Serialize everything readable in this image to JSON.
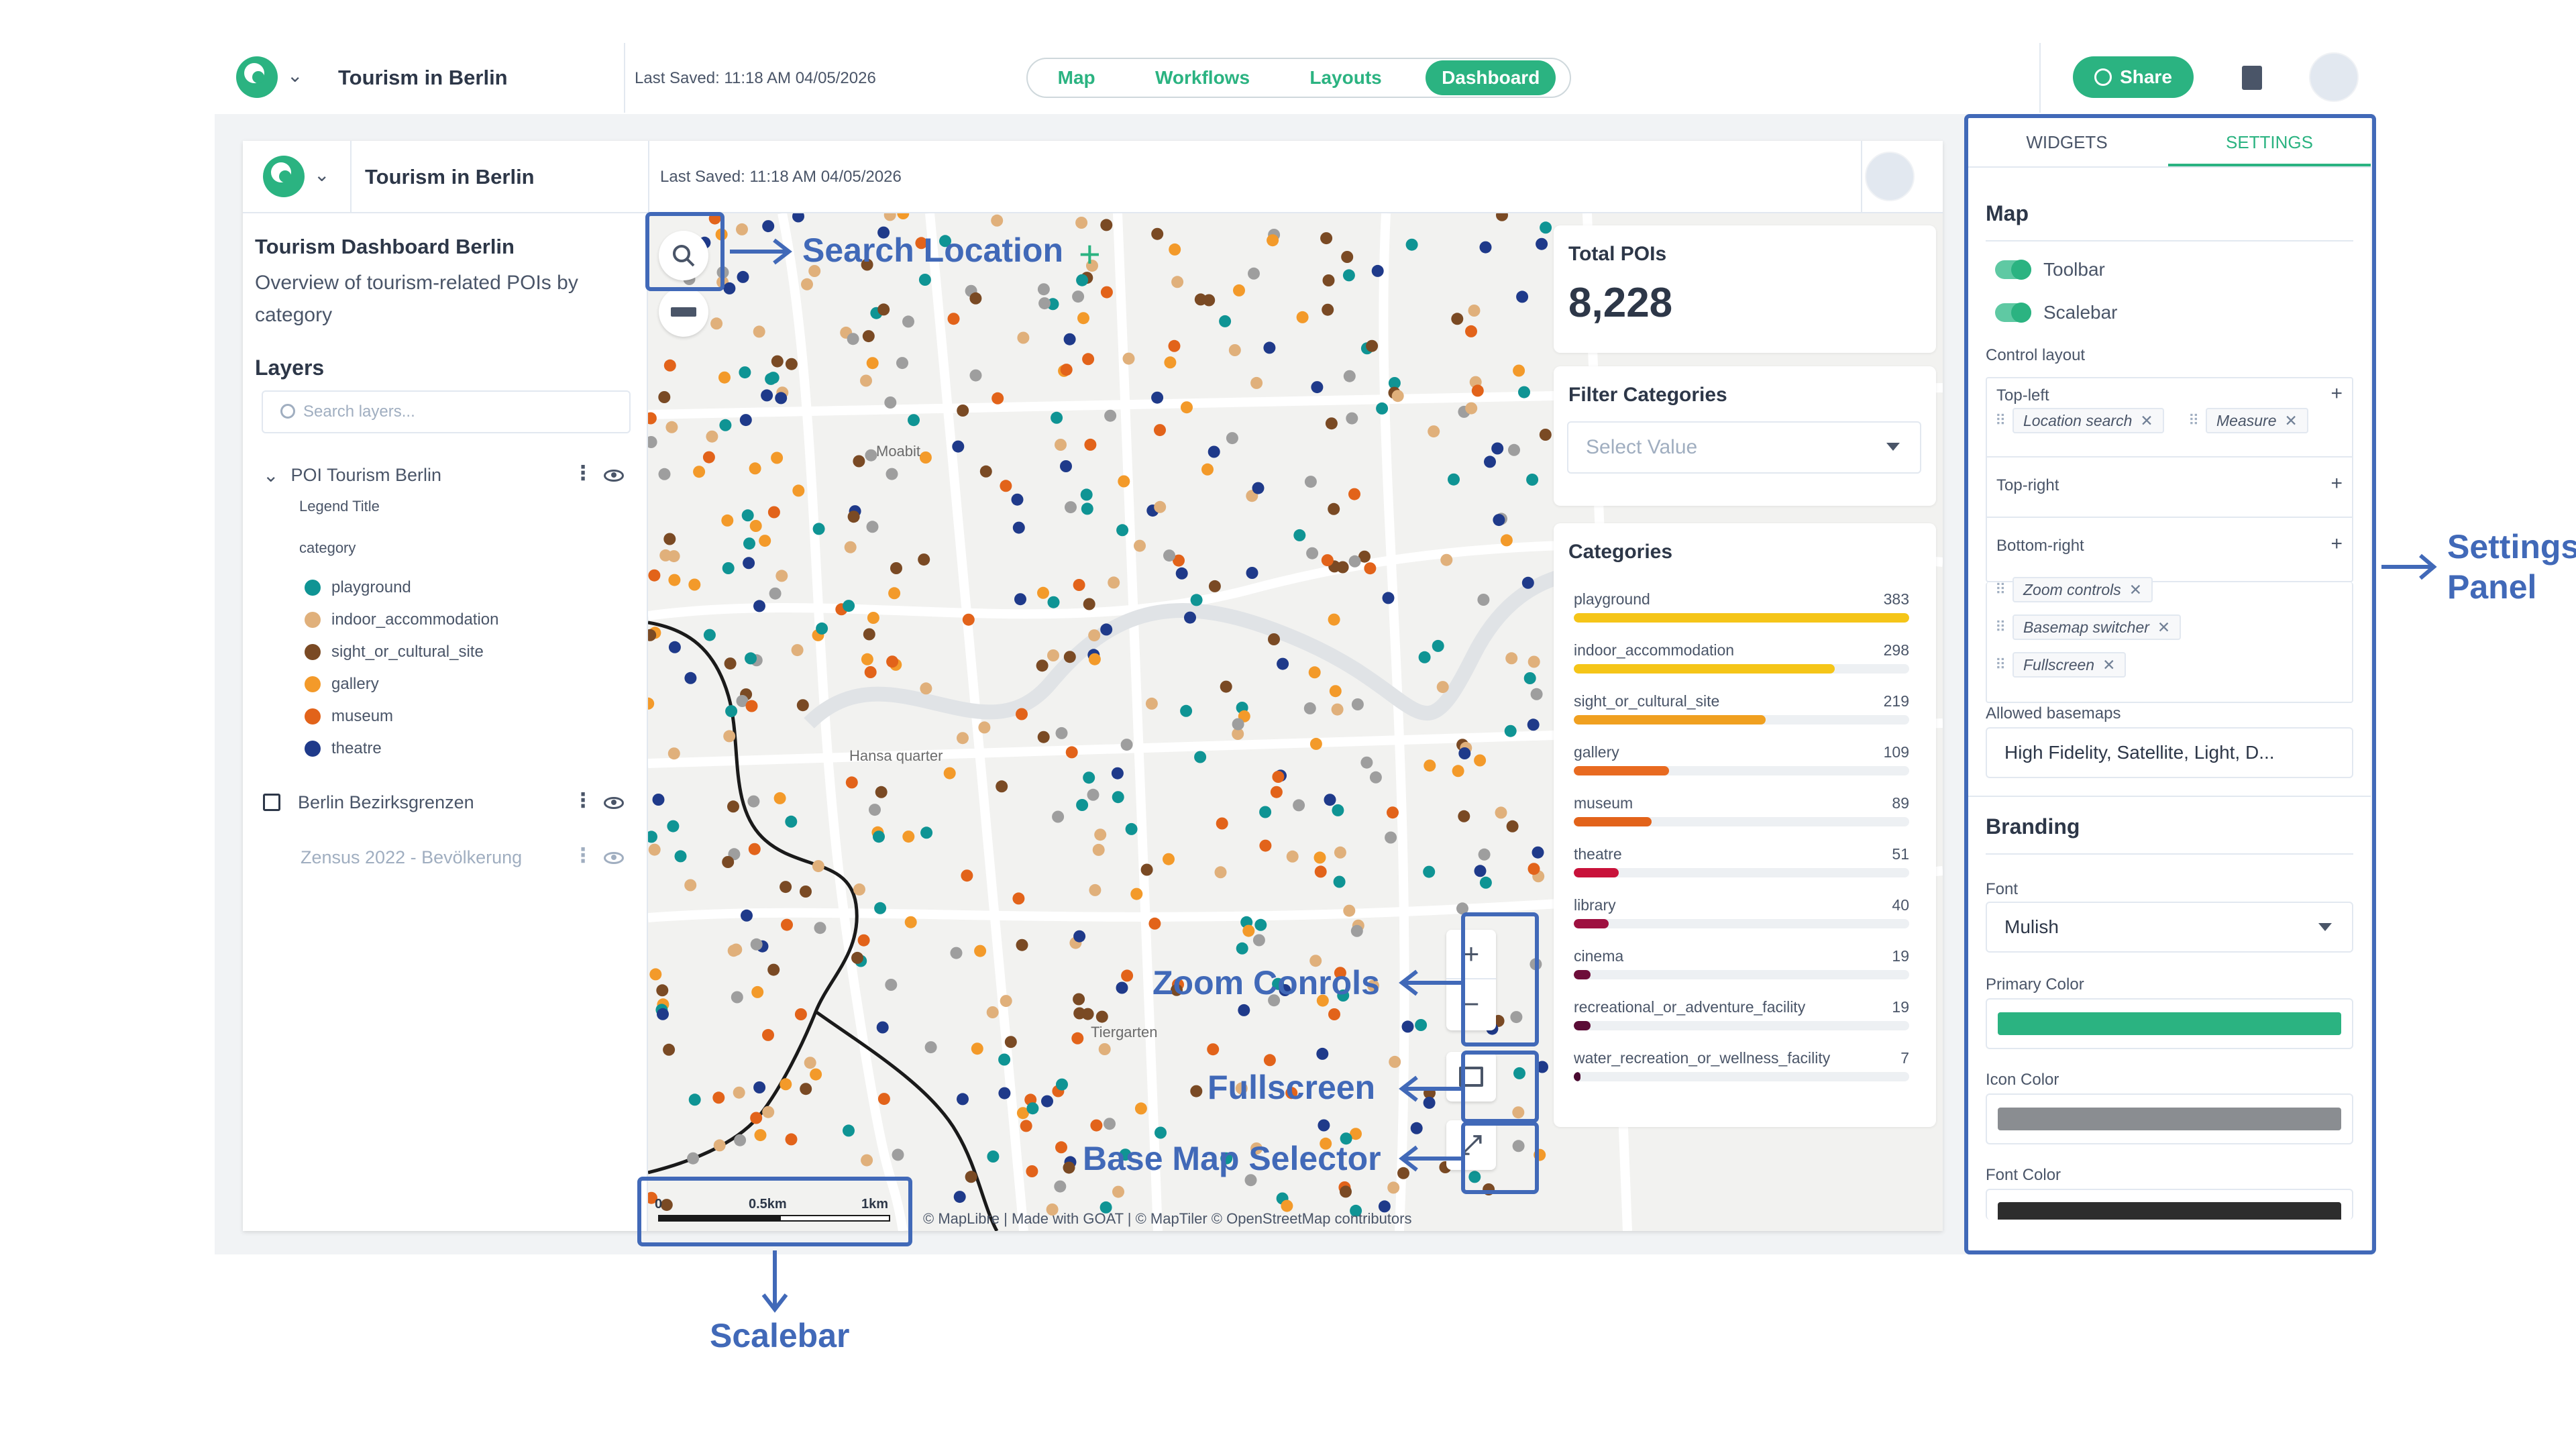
{
  "app": {
    "project_title": "Tourism in Berlin",
    "last_saved": "Last Saved: 11:18 AM 04/05/2026",
    "tabs": [
      {
        "label": "Map",
        "active": false
      },
      {
        "label": "Workflows",
        "active": false
      },
      {
        "label": "Layouts",
        "active": false
      },
      {
        "label": "Dashboard",
        "active": true
      }
    ],
    "share_label": "Share",
    "accent_color": "#2bb381"
  },
  "dashboard": {
    "title": "Tourism Dashboard Berlin",
    "description": "Overview of tourism-related POIs by category",
    "layers_heading": "Layers",
    "search_placeholder": "Search layers...",
    "layers": [
      {
        "name": "POI Tourism Berlin",
        "legend_title": "Legend Title",
        "legend_group": "category"
      },
      {
        "name": "Berlin Bezirksgrenzen"
      },
      {
        "name": "Zensus 2022 - Bevölkerung"
      }
    ],
    "legend": [
      {
        "label": "playground",
        "color": "#0f9494"
      },
      {
        "label": "indoor_accommodation",
        "color": "#e0b07b"
      },
      {
        "label": "sight_or_cultural_site",
        "color": "#7a4a24"
      },
      {
        "label": "gallery",
        "color": "#f39a2a"
      },
      {
        "label": "museum",
        "color": "#e2631a"
      },
      {
        "label": "theatre",
        "color": "#1f3a8a"
      }
    ]
  },
  "map": {
    "labels": [
      "Moabit",
      "Hansa quarter",
      "Tiergarten"
    ],
    "attribution": "© MapLibre | Made with GOAT | © MapTiler © OpenStreetMap contributors",
    "scale_labels": [
      "0",
      "0.5km",
      "1km"
    ]
  },
  "widgets": {
    "total_pois": {
      "title": "Total POIs",
      "value": "8,228"
    },
    "filter": {
      "title": "Filter Categories",
      "placeholder": "Select Value"
    },
    "categories": {
      "title": "Categories",
      "items": [
        {
          "name": "playground",
          "count": 383,
          "color": "#f5c518"
        },
        {
          "name": "indoor_accommodation",
          "count": 298,
          "color": "#f5c518"
        },
        {
          "name": "sight_or_cultural_site",
          "count": 219,
          "color": "#f0a020"
        },
        {
          "name": "gallery",
          "count": 109,
          "color": "#e86a20"
        },
        {
          "name": "museum",
          "count": 89,
          "color": "#e2631a"
        },
        {
          "name": "theatre",
          "count": 51,
          "color": "#c8123a"
        },
        {
          "name": "library",
          "count": 40,
          "color": "#9e1040"
        },
        {
          "name": "cinema",
          "count": 19,
          "color": "#6e0e3a"
        },
        {
          "name": "recreational_or_adventure_facility",
          "count": 19,
          "color": "#5a0c36"
        },
        {
          "name": "water_recreation_or_wellness_facility",
          "count": 7,
          "color": "#4a0a30"
        }
      ]
    }
  },
  "settings": {
    "tabs": [
      "WIDGETS",
      "SETTINGS"
    ],
    "map_heading": "Map",
    "toolbar_label": "Toolbar",
    "scalebar_label": "Scalebar",
    "control_layout_label": "Control layout",
    "top_left": {
      "title": "Top-left",
      "chips": [
        "Location search",
        "Measure"
      ]
    },
    "top_right": {
      "title": "Top-right"
    },
    "bottom_right": {
      "title": "Bottom-right",
      "chips": [
        "Zoom controls",
        "Basemap switcher",
        "Fullscreen"
      ]
    },
    "allowed_basemaps_label": "Allowed basemaps",
    "allowed_basemaps_value": "High Fidelity, Satellite, Light, D...",
    "branding_heading": "Branding",
    "font_label": "Font",
    "font_value": "Mulish",
    "primary_color_label": "Primary Color",
    "primary_color": "#2bb381",
    "icon_color_label": "Icon Color",
    "icon_color": "#8a8d91",
    "font_color_label": "Font Color",
    "font_color": "#2d2d2d"
  },
  "annotations": {
    "search_location": "Search Location",
    "zoom_controls": "Zoom Conrols",
    "fullscreen": "Fullscreen",
    "base_map_selector": "Base Map Selector",
    "scalebar": "Scalebar",
    "settings_panel_line1": "Settings",
    "settings_panel_line2": "Panel",
    "color": "#4169b8"
  }
}
